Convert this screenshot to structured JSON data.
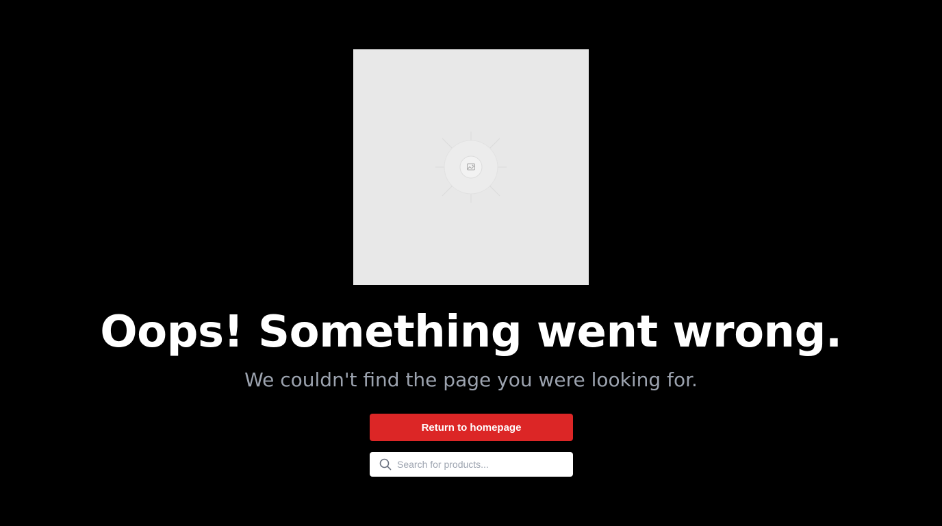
{
  "error": {
    "headline": "Oops! Something went wrong.",
    "message": "We couldn't find the page you were looking for."
  },
  "actions": {
    "return_label": "Return to homepage"
  },
  "search": {
    "placeholder": "Search for products...",
    "value": ""
  },
  "illustration": {
    "icon": "image-placeholder-icon"
  },
  "colors": {
    "background": "#000000",
    "accent": "#dc2626",
    "headline": "#ffffff",
    "subtext": "#9ca3af",
    "placeholder_bg": "#e8e8e8"
  }
}
